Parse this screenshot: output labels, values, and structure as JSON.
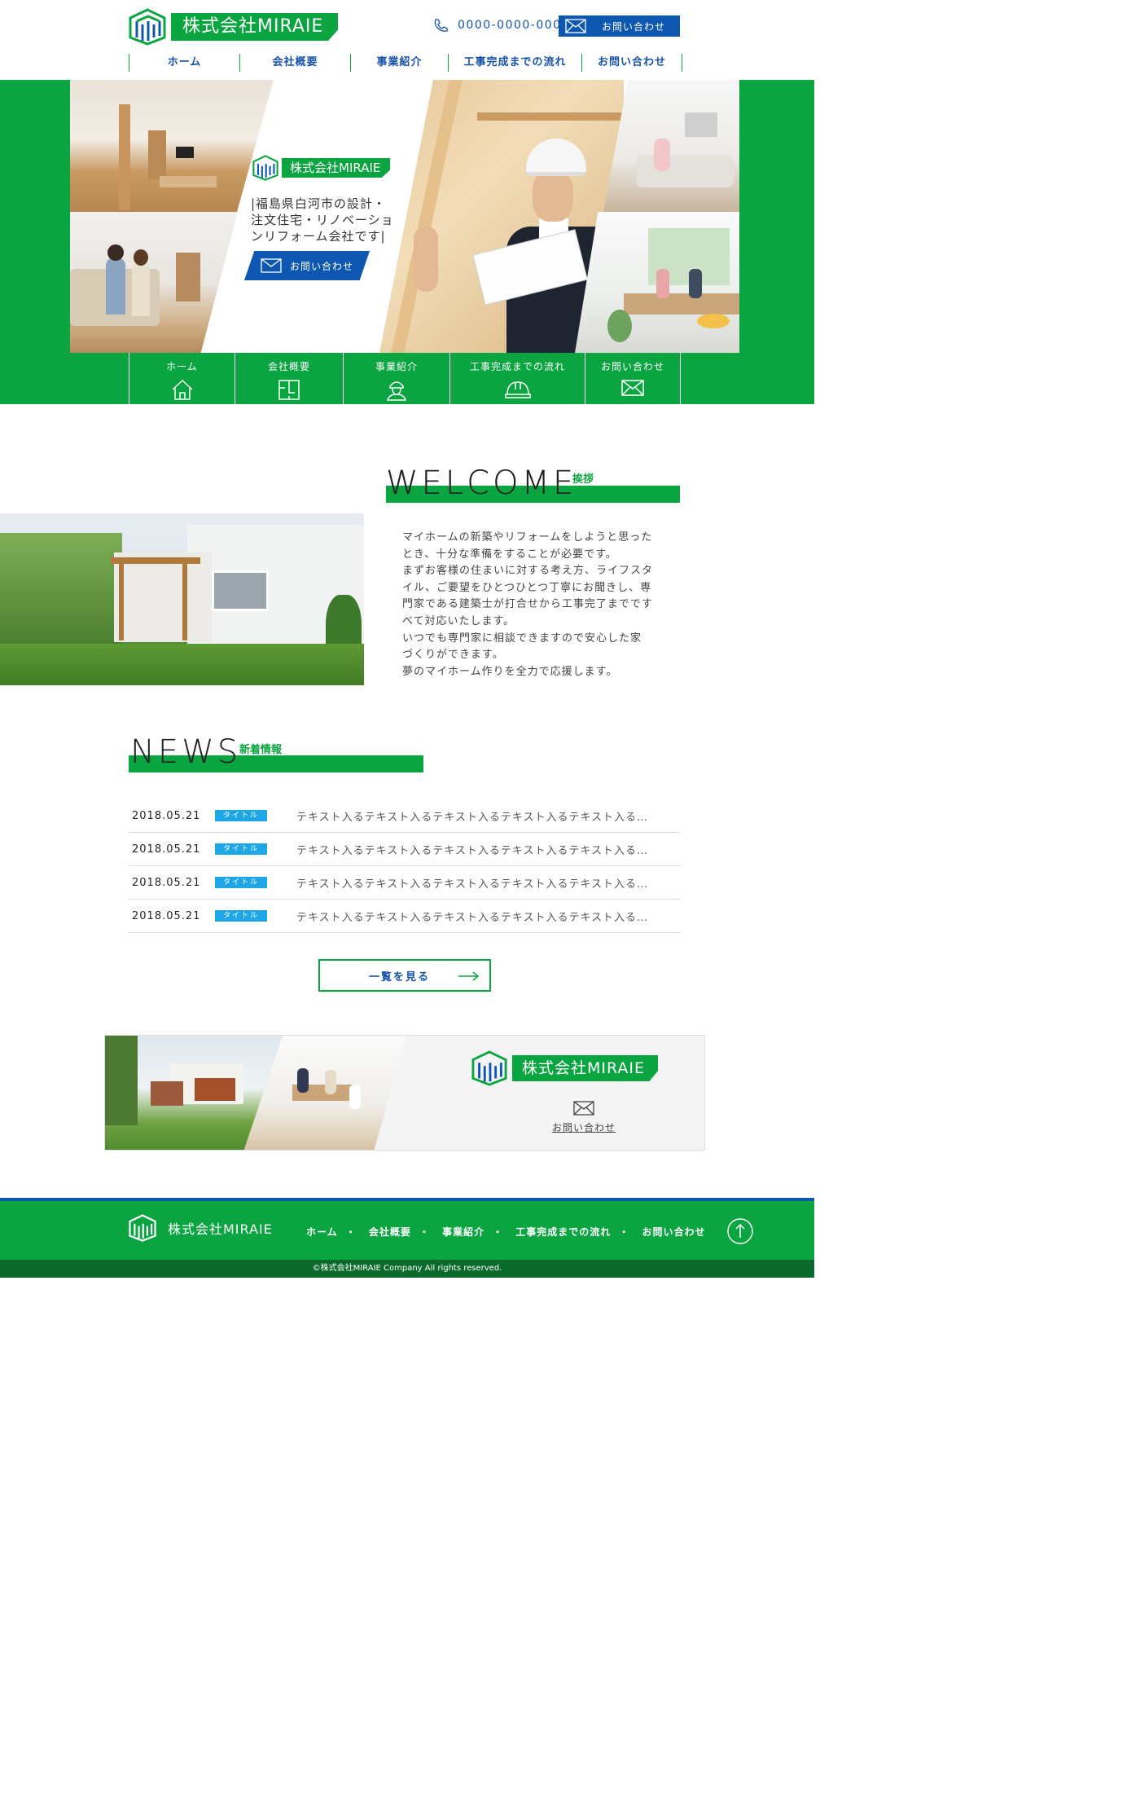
{
  "brand": {
    "name": "株式会社MIRAIE",
    "green": "#0aa441",
    "blue": "#0d57b0"
  },
  "header": {
    "tel": "0000-0000-000",
    "contact_label": "お問い合わせ"
  },
  "nav": [
    "ホーム",
    "会社概要",
    "事業紹介",
    "工事完成までの流れ",
    "お問い合わせ"
  ],
  "hero": {
    "tagline": [
      "|福島県白河市の設計・",
      "注文住宅・リノベーショ",
      "ンリフォーム会社です|"
    ],
    "contact_label": "お問い合わせ"
  },
  "subnav": [
    {
      "label": "ホーム",
      "icon": "house-icon"
    },
    {
      "label": "会社概要",
      "icon": "floorplan-icon"
    },
    {
      "label": "事業紹介",
      "icon": "worker-icon"
    },
    {
      "label": "工事完成までの流れ",
      "icon": "helmet-icon"
    },
    {
      "label": "お問い合わせ",
      "icon": "mail-icon"
    }
  ],
  "welcome": {
    "title": "WELCOME",
    "sub": "挨拶",
    "paragraphs": [
      "マイホームの新築やリフォームをしようと思った",
      "とき、十分な準備をすることが必要です。",
      "まずお客様の住まいに対する考え方、ライフスタ",
      "イル、ご要望をひとつひとつ丁寧にお聞きし、専",
      "門家である建築士が打合せから工事完了までです",
      "べて対応いたします。",
      "いつでも専門家に相談できますので安心した家",
      "づくりができます。",
      "夢のマイホーム作りを全力で応援します。"
    ]
  },
  "news": {
    "title": "NEWS",
    "sub": "新着情報",
    "items": [
      {
        "date": "2018.05.21",
        "tag": "タイトル",
        "text": "テキスト入るテキスト入るテキスト入るテキスト入るテキスト入る…"
      },
      {
        "date": "2018.05.21",
        "tag": "タイトル",
        "text": "テキスト入るテキスト入るテキスト入るテキスト入るテキスト入る…"
      },
      {
        "date": "2018.05.21",
        "tag": "タイトル",
        "text": "テキスト入るテキスト入るテキスト入るテキスト入るテキスト入る…"
      },
      {
        "date": "2018.05.21",
        "tag": "タイトル",
        "text": "テキスト入るテキスト入るテキスト入るテキスト入るテキスト入る…"
      }
    ],
    "more_label": "一覧を見る"
  },
  "banner": {
    "contact_label": "お問い合わせ"
  },
  "footer": {
    "nav": [
      "ホーム",
      "会社概要",
      "事業紹介",
      "工事完成までの流れ",
      "お問い合わせ"
    ],
    "copyright": "©株式会社MIRAIE Company All rights reserved."
  }
}
